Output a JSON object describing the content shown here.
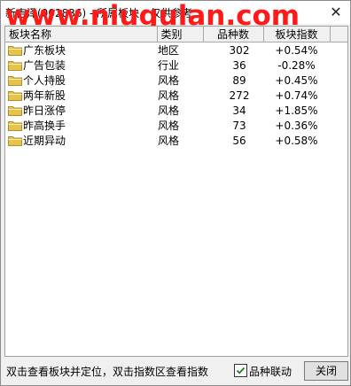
{
  "window": {
    "title": "新吉泽(002836) - 所属板块，仅供参考",
    "watermark": "www.niugulan.com",
    "close_symbol": "✕"
  },
  "table": {
    "headers": [
      "板块名称",
      "类别",
      "品种数",
      "板块指数"
    ],
    "rows": [
      {
        "name": "广东板块",
        "type": "地区",
        "count": "302",
        "index": "+0.54%"
      },
      {
        "name": "广告包装",
        "type": "行业",
        "count": "36",
        "index": "-0.28%"
      },
      {
        "name": "个人持股",
        "type": "风格",
        "count": "89",
        "index": "+0.45%"
      },
      {
        "name": "两年新股",
        "type": "风格",
        "count": "272",
        "index": "+0.74%"
      },
      {
        "name": "昨日涨停",
        "type": "风格",
        "count": "34",
        "index": "+1.85%"
      },
      {
        "name": "昨高换手",
        "type": "风格",
        "count": "73",
        "index": "+0.36%"
      },
      {
        "name": "近期异动",
        "type": "风格",
        "count": "56",
        "index": "+0.58%"
      }
    ]
  },
  "status": {
    "hint": "双击查看板块并定位，双击指数区查看指数",
    "checkbox_label": "品种联动",
    "checkbox_checked": true,
    "close_button": "关闭"
  },
  "colors": {
    "folder": "#e8c34a",
    "watermark": "#ff1a1a",
    "checkmark": "#1a7f1a"
  },
  "icons": {
    "row_icon": "folder-icon",
    "check_icon": "checkmark-icon"
  }
}
